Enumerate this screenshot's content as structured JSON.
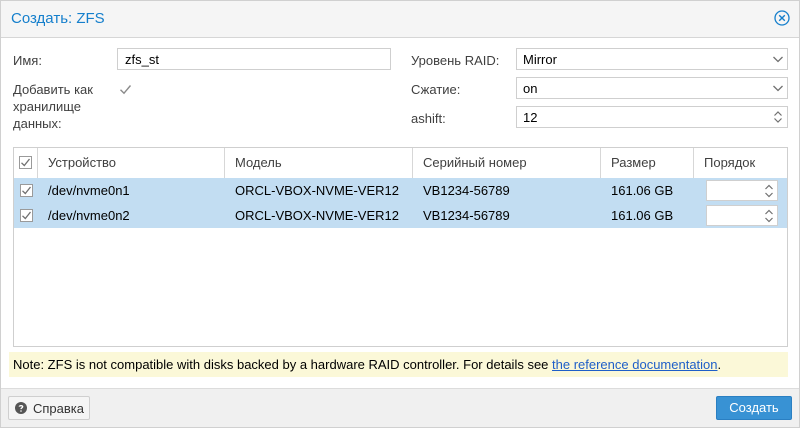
{
  "window": {
    "title": "Создать: ZFS"
  },
  "form": {
    "name_label": "Имя:",
    "name_value": "zfs_st",
    "add_storage_label_1": "Добавить как",
    "add_storage_label_2": "хранилище",
    "add_storage_label_3": "данных:",
    "add_storage_checked": true,
    "raid_label": "Уровень RAID:",
    "raid_value": "Mirror",
    "compression_label": "Сжатие:",
    "compression_value": "on",
    "ashift_label": "ashift:",
    "ashift_value": "12"
  },
  "grid": {
    "columns": [
      "Устройство",
      "Модель",
      "Серийный номер",
      "Размер",
      "Порядок"
    ],
    "rows": [
      {
        "device": "/dev/nvme0n1",
        "model": "ORCL-VBOX-NVME-VER12",
        "serial": "VB1234-56789",
        "size": "161.06 GB",
        "checked": true
      },
      {
        "device": "/dev/nvme0n2",
        "model": "ORCL-VBOX-NVME-VER12",
        "serial": "VB1234-56789",
        "size": "161.06 GB",
        "checked": true
      }
    ]
  },
  "note": {
    "text": "Note: ZFS is not compatible with disks backed by a hardware RAID controller. For details see ",
    "link": "the reference documentation",
    "end": "."
  },
  "footer": {
    "help_label": "Справка",
    "create_label": "Создать"
  },
  "colors": {
    "accent": "#157fcc",
    "selected_row": "#c2ddf2",
    "primary_button": "#3892d4",
    "note_bg": "#fbf8d8"
  }
}
